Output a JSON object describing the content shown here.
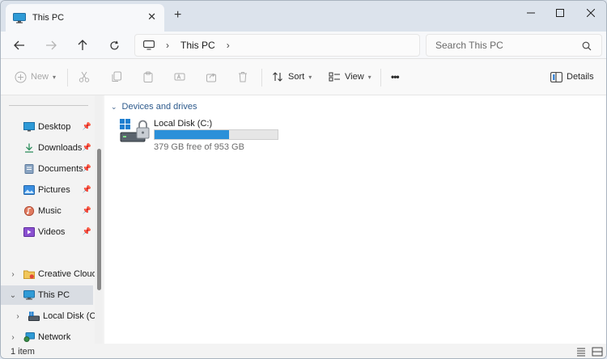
{
  "tab": {
    "title": "This PC",
    "close": "✕",
    "add": "+"
  },
  "window_controls": {
    "minimize": "—",
    "maximize": "☐",
    "close": "✕"
  },
  "address": {
    "breadcrumbs": [
      "This PC"
    ],
    "chevron": "›"
  },
  "search": {
    "placeholder": "Search This PC"
  },
  "commands": {
    "new": "New",
    "sort": "Sort",
    "view": "View",
    "more": "•••",
    "details": "Details"
  },
  "quick_access": [
    {
      "label": "Desktop",
      "icon": "desktop-icon"
    },
    {
      "label": "Downloads",
      "icon": "downloads-icon"
    },
    {
      "label": "Documents",
      "icon": "documents-icon"
    },
    {
      "label": "Pictures",
      "icon": "pictures-icon"
    },
    {
      "label": "Music",
      "icon": "music-icon"
    },
    {
      "label": "Videos",
      "icon": "videos-icon"
    }
  ],
  "tree": {
    "creative_cloud": "Creative Cloud F",
    "this_pc": "This PC",
    "local_disk": "Local Disk (C:)",
    "network": "Network"
  },
  "content": {
    "group_label": "Devices and drives",
    "drives": [
      {
        "name": "Local Disk (C:)",
        "free_text": "379 GB free of 953 GB",
        "used_fraction": 0.602
      }
    ]
  },
  "status": {
    "item_count": "1 item"
  },
  "colors": {
    "accent": "#2b90d9",
    "group_heading": "#2d5a8c",
    "selected_bg": "#d9dde3"
  }
}
